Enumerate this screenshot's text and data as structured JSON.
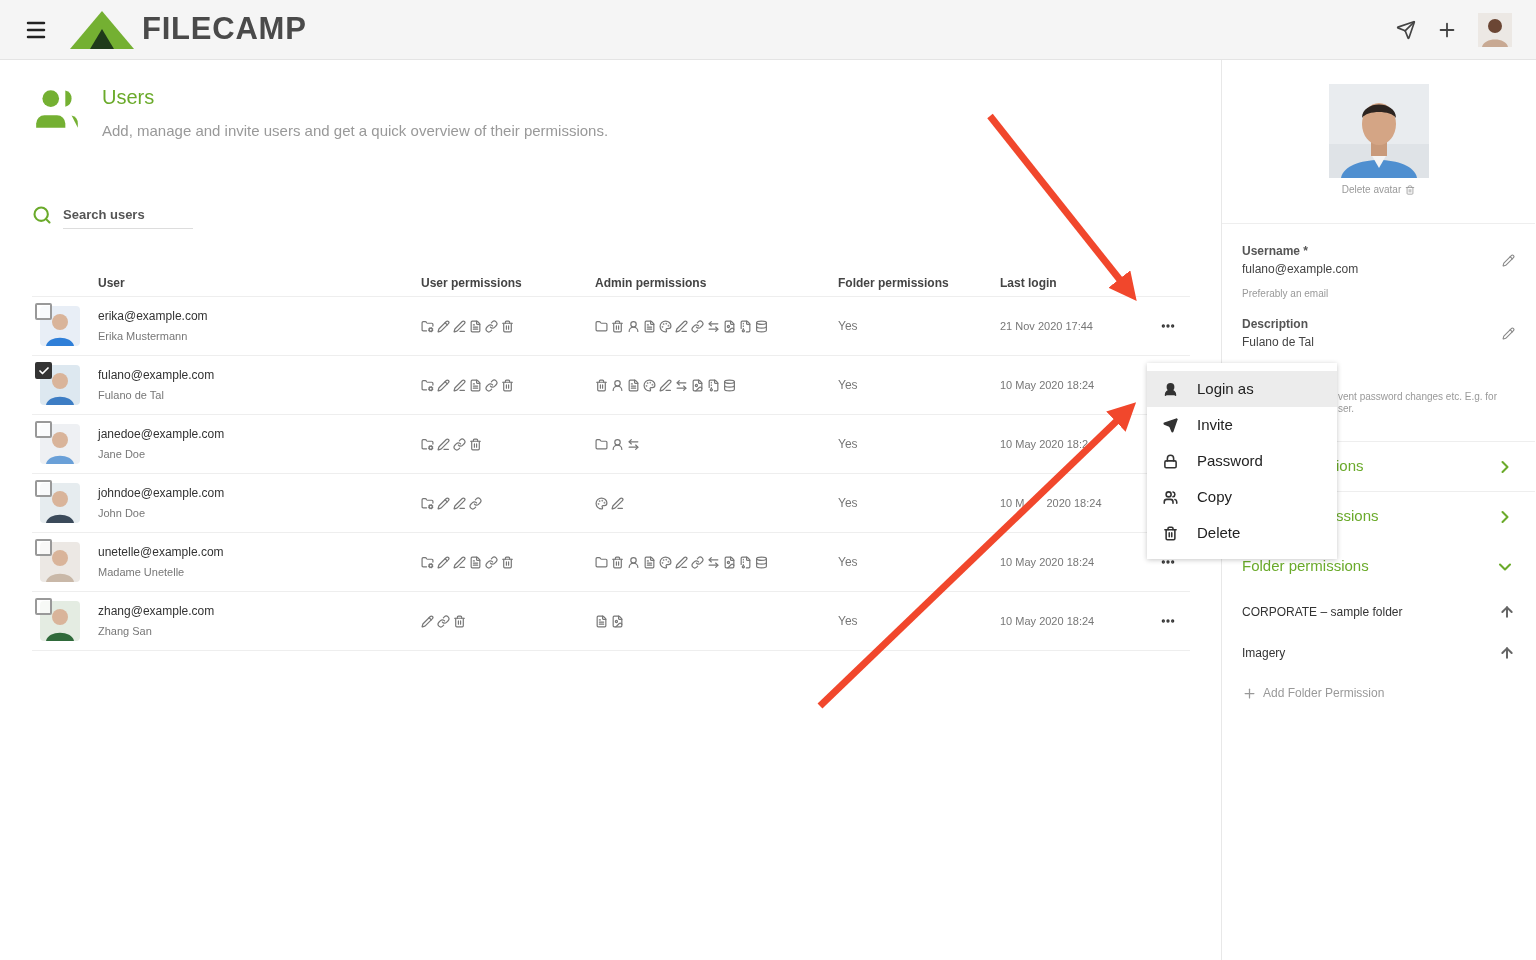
{
  "header": {
    "logo": "FILECAMP"
  },
  "page": {
    "title": "Users",
    "subtitle": "Add, manage and invite users and get a quick overview of their permissions."
  },
  "search": {
    "placeholder": "Search users"
  },
  "table": {
    "columns": [
      "User",
      "User permissions",
      "Admin permissions",
      "Folder permissions",
      "Last login"
    ],
    "rows": [
      {
        "email": "erika@example.com",
        "name": "Erika Mustermann",
        "checked": false,
        "more_button_visible": true,
        "user_permissions": [
          {
            "kind": "folder-cog"
          },
          {
            "kind": "pencil"
          },
          {
            "kind": "pen"
          },
          {
            "kind": "file"
          },
          {
            "kind": "link"
          },
          {
            "kind": "trash"
          }
        ],
        "admin_permissions": [
          {
            "kind": "folder"
          },
          {
            "kind": "trash"
          },
          {
            "kind": "user"
          },
          {
            "kind": "file"
          },
          {
            "kind": "palette"
          },
          {
            "kind": "pen"
          },
          {
            "kind": "link"
          },
          {
            "kind": "swap"
          },
          {
            "kind": "file-image"
          },
          {
            "kind": "file-archive"
          },
          {
            "kind": "database"
          }
        ],
        "folder_permissions": "Yes",
        "last_login": [
          "21 Nov 2020 17:44"
        ]
      },
      {
        "email": "fulano@example.com",
        "name": "Fulano de Tal",
        "checked": true,
        "more_button_visible": false,
        "user_permissions": [
          {
            "kind": "folder-cog"
          },
          {
            "kind": "pencil"
          },
          {
            "kind": "pen"
          },
          {
            "kind": "file"
          },
          {
            "kind": "link"
          },
          {
            "kind": "trash"
          }
        ],
        "admin_permissions": [
          {
            "kind": "trash"
          },
          {
            "kind": "user"
          },
          {
            "kind": "file"
          },
          {
            "kind": "palette"
          },
          {
            "kind": "pen"
          },
          {
            "kind": "swap"
          },
          {
            "kind": "file-image"
          },
          {
            "kind": "file-archive"
          },
          {
            "kind": "database"
          }
        ],
        "folder_permissions": "Yes",
        "last_login": [
          "10 May 2020 18:24"
        ]
      },
      {
        "email": "janedoe@example.com",
        "name": "Jane Doe",
        "checked": false,
        "more_button_visible": false,
        "user_permissions": [
          {
            "kind": "folder-cog"
          },
          {
            "kind": "pen"
          },
          {
            "kind": "link"
          },
          {
            "kind": "trash"
          }
        ],
        "admin_permissions": [
          {
            "kind": "folder"
          },
          {
            "kind": "user"
          },
          {
            "kind": "swap"
          }
        ],
        "folder_permissions": "Yes",
        "last_login": [
          "10 May 2020 18:2"
        ]
      },
      {
        "email": "johndoe@example.com",
        "name": "John Doe",
        "checked": false,
        "more_button_visible": false,
        "user_permissions": [
          {
            "kind": "folder-cog"
          },
          {
            "kind": "pencil"
          },
          {
            "kind": "pen"
          },
          {
            "kind": "link"
          }
        ],
        "admin_permissions": [
          {
            "kind": "palette"
          },
          {
            "kind": "pen"
          }
        ],
        "folder_permissions": "Yes",
        "last_login": [
          "10 M",
          "2020 18:24"
        ]
      },
      {
        "email": "unetelle@example.com",
        "name": "Madame Unetelle",
        "checked": false,
        "more_button_visible": true,
        "user_permissions": [
          {
            "kind": "folder-cog"
          },
          {
            "kind": "pencil"
          },
          {
            "kind": "pen"
          },
          {
            "kind": "file"
          },
          {
            "kind": "link"
          },
          {
            "kind": "trash"
          }
        ],
        "admin_permissions": [
          {
            "kind": "folder"
          },
          {
            "kind": "trash"
          },
          {
            "kind": "user"
          },
          {
            "kind": "file"
          },
          {
            "kind": "palette"
          },
          {
            "kind": "pen"
          },
          {
            "kind": "link"
          },
          {
            "kind": "swap"
          },
          {
            "kind": "file-image"
          },
          {
            "kind": "file-archive"
          },
          {
            "kind": "database"
          }
        ],
        "folder_permissions": "Yes",
        "last_login": [
          "10 May 2020 18:24"
        ]
      },
      {
        "email": "zhang@example.com",
        "name": "Zhang San",
        "checked": false,
        "more_button_visible": true,
        "user_permissions": [
          {
            "kind": "pencil"
          },
          {
            "kind": "link"
          },
          {
            "kind": "trash"
          }
        ],
        "admin_permissions": [
          {
            "kind": "file"
          },
          {
            "kind": "file-image"
          }
        ],
        "folder_permissions": "Yes",
        "last_login": [
          "10 May 2020 18:24"
        ]
      }
    ]
  },
  "context_menu": {
    "items": [
      {
        "kind": "user",
        "label": "Login as",
        "selected": true
      },
      {
        "kind": "send",
        "label": "Invite",
        "selected": false
      },
      {
        "kind": "lock",
        "label": "Password",
        "selected": false
      },
      {
        "kind": "copy",
        "label": "Copy",
        "selected": false
      },
      {
        "kind": "trash",
        "label": "Delete",
        "selected": false
      }
    ]
  },
  "detail_panel": {
    "delete_avatar": "Delete avatar",
    "fields": [
      {
        "label": "Username *",
        "value": "fulano@example.com",
        "hint": "Preferably an email"
      },
      {
        "label": "Description",
        "value": "Fulano de Tal"
      }
    ],
    "hidden_hint": [
      "vent password changes etc. E.g. for",
      "ser."
    ],
    "sections": [
      {
        "title": "ions",
        "expanded": false
      },
      {
        "title": "ssions",
        "expanded": false
      },
      {
        "title": "Folder permissions",
        "expanded": true
      }
    ],
    "folders": [
      "CORPORATE – sample folder",
      "Imagery"
    ],
    "add_folder": "Add Folder Permission"
  }
}
